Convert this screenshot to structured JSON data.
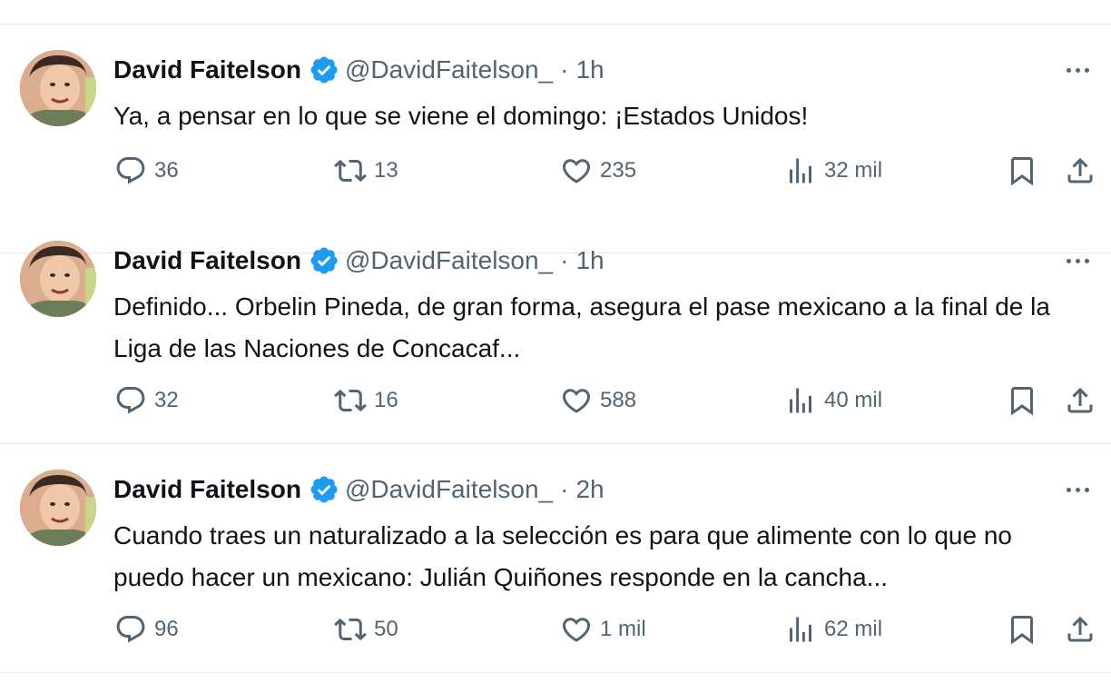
{
  "tweets": [
    {
      "author": "David Faitelson",
      "handle": "@DavidFaitelson_",
      "separator": "·",
      "time": "1h",
      "text": "Ya, a pensar en lo que se viene el domingo: ¡Estados Unidos!",
      "replies": "36",
      "retweets": "13",
      "likes": "235",
      "views": "32 mil"
    },
    {
      "author": "David Faitelson",
      "handle": "@DavidFaitelson_",
      "separator": "·",
      "time": "1h",
      "text": "Definido... Orbelin Pineda, de gran forma, asegura el pase mexicano a la final de la Liga de las Naciones de Concacaf...",
      "replies": "32",
      "retweets": "16",
      "likes": "588",
      "views": "40 mil"
    },
    {
      "author": "David Faitelson",
      "handle": "@DavidFaitelson_",
      "separator": "·",
      "time": "2h",
      "text": "Cuando traes un naturalizado a la selección es para que alimente con lo que no puedo hacer un mexicano: Julián Quiñones responde en la cancha...",
      "replies": "96",
      "retweets": "50",
      "likes": "1 mil",
      "views": "62 mil"
    }
  ],
  "icons": {
    "reply": "reply-icon",
    "retweet": "retweet-icon",
    "like": "heart-icon",
    "views": "views-icon",
    "bookmark": "bookmark-icon",
    "share": "share-icon",
    "verified": "verified-badge-icon",
    "more": "more-icon"
  },
  "colors": {
    "verified": "#1d9bf0",
    "text": "#0f1419",
    "secondary": "#536471",
    "divider": "#e3e7ea"
  }
}
